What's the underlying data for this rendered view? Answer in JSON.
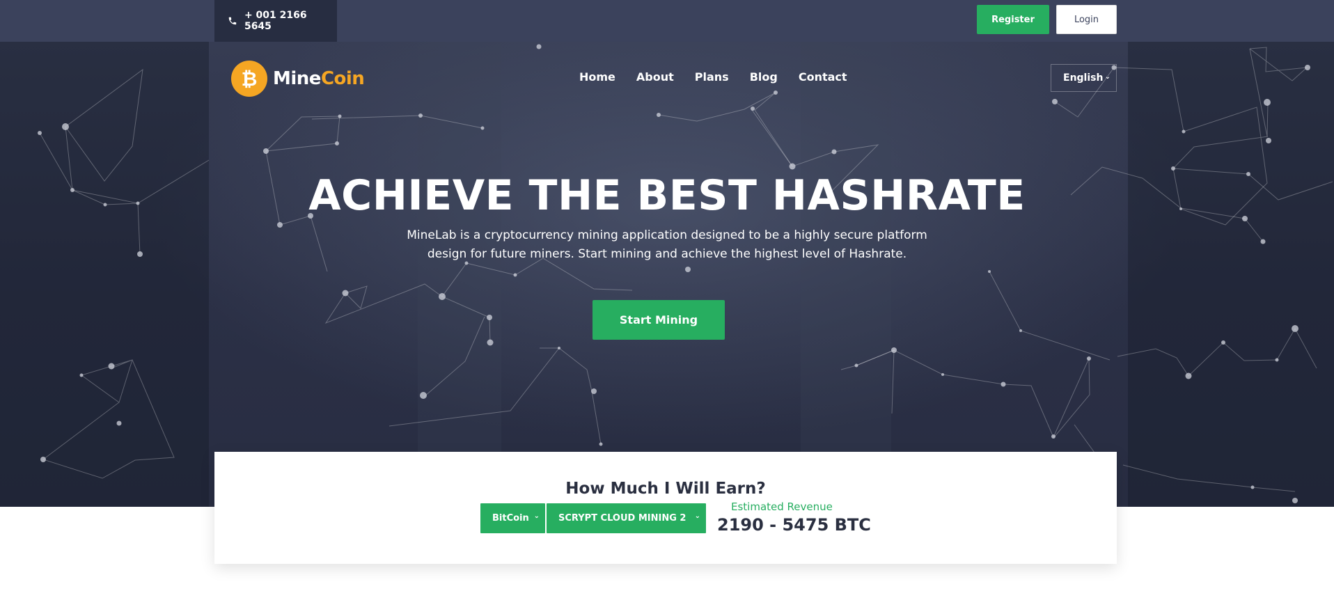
{
  "topbar": {
    "phone": "+ 001 2166 5645",
    "register_label": "Register",
    "login_label": "Login"
  },
  "brand": {
    "coin_symbol": "₿",
    "name_part1": "Mine",
    "name_part2": "Coin"
  },
  "nav": {
    "items": [
      {
        "label": "Home"
      },
      {
        "label": "About"
      },
      {
        "label": "Plans"
      },
      {
        "label": "Blog"
      },
      {
        "label": "Contact"
      }
    ],
    "language": "English"
  },
  "hero": {
    "title": "ACHIEVE THE BEST HASHRATE",
    "subtitle": "MineLab is a cryptocurrency mining application designed to be a highly secure platform design for future miners. Start mining and achieve the highest level of Hashrate.",
    "cta_label": "Start Mining"
  },
  "calculator": {
    "title": "How Much I Will Earn?",
    "coin_select": "BitCoin",
    "plan_select": "SCRYPT CLOUD MINING 2",
    "estimate_label": "Estimated Revenue",
    "estimate_value": "2190 - 5475 BTC"
  },
  "colors": {
    "accent_green": "#27ae60",
    "brand_orange": "#f5a623",
    "topbar_bg": "#3b425c",
    "hero_bg": "#2b3046"
  },
  "icons": {
    "phone": "phone-icon",
    "dropdown": "chevron-down-icon"
  }
}
